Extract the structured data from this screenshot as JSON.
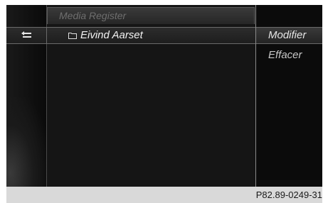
{
  "header": {
    "title": "Media Register"
  },
  "list": {
    "items": [
      {
        "label": "Eivind Aarset",
        "icon": "folder-icon"
      }
    ]
  },
  "nav": {
    "back_icon": "back-arrow-icon"
  },
  "context_menu": {
    "items": [
      {
        "label": "Modifier",
        "selected": true
      },
      {
        "label": "Effacer",
        "selected": false
      }
    ]
  },
  "footer": {
    "code": "P82.89-0249-31"
  },
  "colors": {
    "screen_background": "#0b0b0b",
    "text_primary": "#f2f2f2",
    "text_dim": "#6e6e6e",
    "highlight_border": "#6a6a6a",
    "footer_band": "#d9d9d9"
  }
}
